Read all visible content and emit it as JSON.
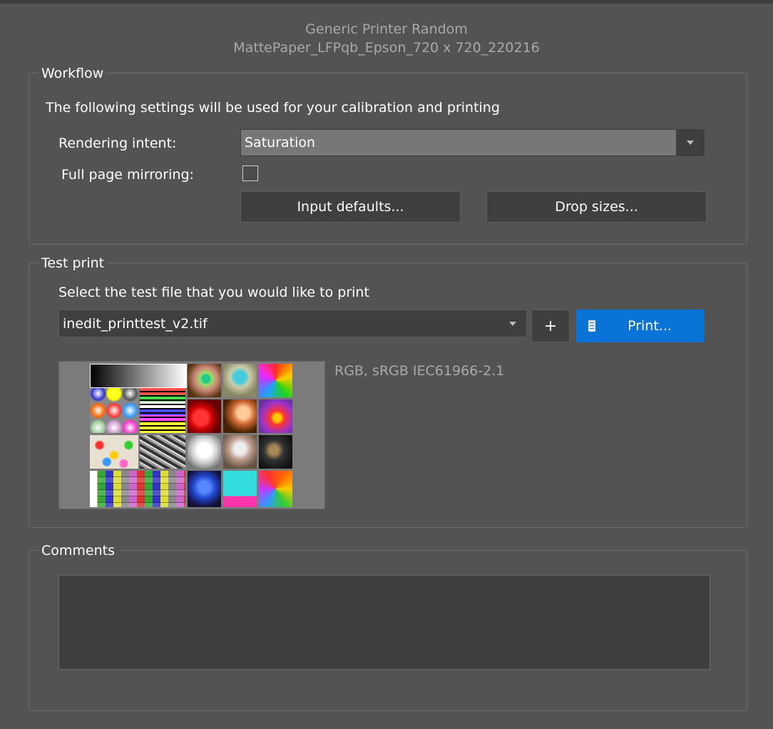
{
  "header": {
    "printer_name": "Generic Printer Random",
    "profile_name": "MattePaper_LFPqb_Epson_720 x 720_220216"
  },
  "workflow": {
    "title": "Workflow",
    "description": "The following settings will be used for your calibration and printing",
    "rendering_intent_label": "Rendering intent:",
    "rendering_intent_value": "Saturation",
    "mirroring_label": "Full page mirroring:",
    "mirroring_checked": false,
    "input_defaults_button": "Input defaults...",
    "drop_sizes_button": "Drop sizes..."
  },
  "test_print": {
    "title": "Test print",
    "instruction": "Select the test file that you would like to print",
    "file_value": "inedit_printtest_v2.tif",
    "add_button": "+",
    "print_button": "Print...",
    "color_space": "RGB, sRGB IEC61966-2.1",
    "thumbnail_icon": "test-chart-thumbnail"
  },
  "comments": {
    "title": "Comments",
    "value": ""
  },
  "colors": {
    "background": "#535353",
    "accent": "#0a74d6",
    "button": "#3f3f3f",
    "combo_selected": "#777777"
  }
}
